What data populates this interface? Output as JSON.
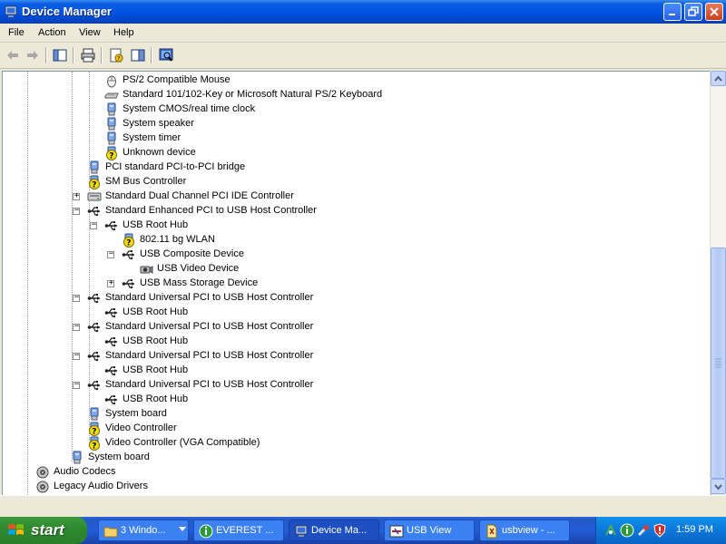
{
  "window": {
    "title": "Device Manager",
    "icon": "computer-icon"
  },
  "menu": [
    "File",
    "Action",
    "View",
    "Help"
  ],
  "toolbar": {
    "buttons": [
      "back-icon",
      "forward-icon",
      "show-hide-tree-icon",
      "print-icon",
      "properties-icon",
      "help-icon",
      "scan-hardware-icon"
    ]
  },
  "tree": [
    {
      "label": "PS/2 Compatible Mouse",
      "icon": "mouse-icon",
      "level": 4,
      "expander": ""
    },
    {
      "label": "Standard 101/102-Key or Microsoft Natural PS/2 Keyboard",
      "icon": "keyboard-icon",
      "level": 4,
      "expander": ""
    },
    {
      "label": "System CMOS/real time clock",
      "icon": "system-device-icon",
      "level": 4,
      "expander": ""
    },
    {
      "label": "System speaker",
      "icon": "system-device-icon",
      "level": 4,
      "expander": ""
    },
    {
      "label": "System timer",
      "icon": "system-device-icon",
      "level": 4,
      "expander": ""
    },
    {
      "label": "Unknown device",
      "icon": "warning-device-icon",
      "level": 4,
      "expander": ""
    },
    {
      "label": "PCI standard PCI-to-PCI bridge",
      "icon": "system-device-icon",
      "level": 3,
      "expander": ""
    },
    {
      "label": "SM Bus Controller",
      "icon": "warning-device-icon",
      "level": 3,
      "expander": ""
    },
    {
      "label": "Standard Dual Channel PCI IDE Controller",
      "icon": "ide-controller-icon",
      "level": 3,
      "expander": "+"
    },
    {
      "label": "Standard Enhanced PCI to USB Host Controller",
      "icon": "usb-icon",
      "level": 3,
      "expander": "−"
    },
    {
      "label": "USB Root Hub",
      "icon": "usb-icon",
      "level": 4,
      "expander": "−"
    },
    {
      "label": "802.11 bg WLAN",
      "icon": "warning-device-icon",
      "level": 5,
      "expander": ""
    },
    {
      "label": "USB Composite Device",
      "icon": "usb-icon",
      "level": 5,
      "expander": "−"
    },
    {
      "label": "USB Video Device",
      "icon": "camera-icon",
      "level": 6,
      "expander": ""
    },
    {
      "label": "USB Mass Storage Device",
      "icon": "usb-icon",
      "level": 5,
      "expander": "+"
    },
    {
      "label": "Standard Universal PCI to USB Host Controller",
      "icon": "usb-icon",
      "level": 3,
      "expander": "−"
    },
    {
      "label": "USB Root Hub",
      "icon": "usb-icon",
      "level": 4,
      "expander": ""
    },
    {
      "label": "Standard Universal PCI to USB Host Controller",
      "icon": "usb-icon",
      "level": 3,
      "expander": "−"
    },
    {
      "label": "USB Root Hub",
      "icon": "usb-icon",
      "level": 4,
      "expander": ""
    },
    {
      "label": "Standard Universal PCI to USB Host Controller",
      "icon": "usb-icon",
      "level": 3,
      "expander": "−"
    },
    {
      "label": "USB Root Hub",
      "icon": "usb-icon",
      "level": 4,
      "expander": ""
    },
    {
      "label": "Standard Universal PCI to USB Host Controller",
      "icon": "usb-icon",
      "level": 3,
      "expander": "−"
    },
    {
      "label": "USB Root Hub",
      "icon": "usb-icon",
      "level": 4,
      "expander": ""
    },
    {
      "label": "System board",
      "icon": "system-device-icon",
      "level": 3,
      "expander": ""
    },
    {
      "label": "Video Controller",
      "icon": "warning-device-icon",
      "level": 3,
      "expander": ""
    },
    {
      "label": "Video Controller (VGA Compatible)",
      "icon": "warning-device-icon",
      "level": 3,
      "expander": ""
    },
    {
      "label": "System board",
      "icon": "system-device-icon",
      "level": 2,
      "expander": ""
    },
    {
      "label": "Audio Codecs",
      "icon": "audio-icon",
      "level": 0,
      "expander": ""
    },
    {
      "label": "Legacy Audio Drivers",
      "icon": "audio-icon",
      "level": 0,
      "expander": ""
    }
  ],
  "taskbar": {
    "start_label": "start",
    "tasks": [
      {
        "label": "3 Windo...",
        "icon": "folder-icon",
        "active": false
      },
      {
        "label": "EVEREST ...",
        "icon": "everest-icon",
        "active": false
      },
      {
        "label": "Device Ma...",
        "icon": "computer-icon",
        "active": true
      },
      {
        "label": "USB View",
        "icon": "usbview-icon",
        "active": false
      },
      {
        "label": "usbview - ...",
        "icon": "document-icon",
        "active": false
      }
    ],
    "tray_icons": [
      "network-icon",
      "info-icon",
      "tool-icon",
      "security-shield-icon"
    ],
    "clock": "1:59 PM"
  }
}
